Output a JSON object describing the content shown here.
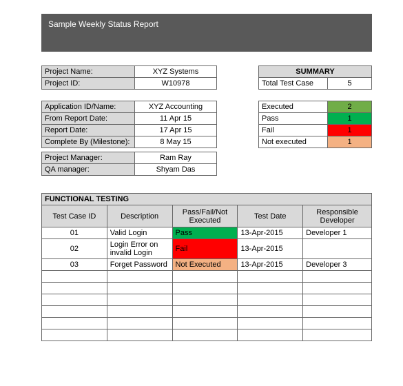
{
  "header": {
    "title": "Sample Weekly Status Report"
  },
  "project": {
    "rows": [
      {
        "label": "Project Name:",
        "value": "XYZ Systems"
      },
      {
        "label": "Project ID:",
        "value": "W10978"
      }
    ],
    "rows2": [
      {
        "label": "Application ID/Name:",
        "value": "XYZ Accounting"
      },
      {
        "label": "From Report Date:",
        "value": "11 Apr 15"
      },
      {
        "label": "Report Date:",
        "value": "17 Apr 15"
      },
      {
        "label": "Complete By (Milestone):",
        "value": "8 May 15"
      }
    ]
  },
  "summary": {
    "title": "SUMMARY",
    "totalRow": {
      "label": "Total Test Case",
      "value": "5",
      "bg": "#ffffff"
    },
    "rows": [
      {
        "label": "Executed",
        "value": "2",
        "bg": "#70ad47"
      },
      {
        "label": "Pass",
        "value": "1",
        "bg": "#00b050"
      },
      {
        "label": "Fail",
        "value": "1",
        "bg": "#ff0000"
      },
      {
        "label": "Not executed",
        "value": "1",
        "bg": "#f4b183"
      }
    ]
  },
  "managers": {
    "rows": [
      {
        "label": "Project Manager:",
        "value": "Ram Ray"
      },
      {
        "label": "QA manager:",
        "value": "Shyam Das"
      }
    ]
  },
  "testing": {
    "title": "FUNCTIONAL TESTING",
    "columns": [
      "Test Case ID",
      "Description",
      "Pass/Fail/Not Executed",
      "Test Date",
      "Responsible Developer"
    ],
    "rows": [
      {
        "id": "01",
        "desc": "Valid Login",
        "status": "Pass",
        "statusBg": "#00b050",
        "date": "13-Apr-2015",
        "dev": "Developer 1"
      },
      {
        "id": "02",
        "desc": "Login Error on invalid Login",
        "status": "Fail",
        "statusBg": "#ff0000",
        "date": "13-Apr-2015",
        "dev": ""
      },
      {
        "id": "03",
        "desc": "Forget Password",
        "status": "Not Executed",
        "statusBg": "#f4b183",
        "date": "13-Apr-2015",
        "dev": "Developer 3"
      }
    ],
    "emptyRows": 6
  }
}
